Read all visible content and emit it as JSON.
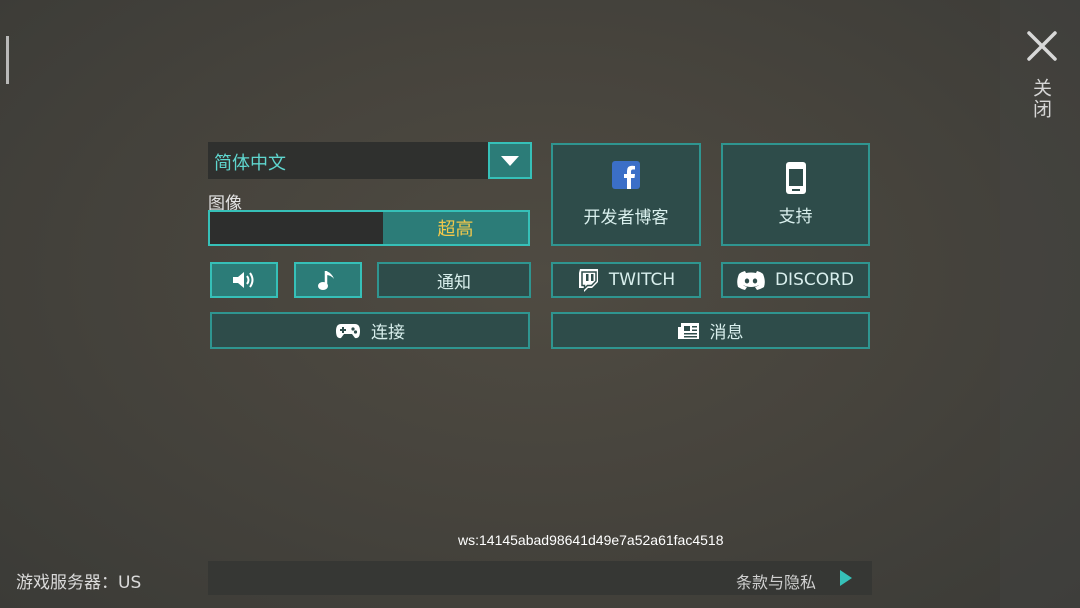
{
  "close": {
    "label": "关闭"
  },
  "language": {
    "selected": "简体中文"
  },
  "graphics": {
    "label": "图像",
    "quality": "超高"
  },
  "buttons": {
    "notify": "通知",
    "connect": "连接",
    "dev_blog": "开发者博客",
    "support": "支持",
    "twitch": "TWITCH",
    "discord": "DISCORD",
    "news": "消息"
  },
  "footer": {
    "server": "游戏服务器：US",
    "ws_id": "ws:14145abad98641d49e7a52a61fac4518",
    "terms": "条款与隐私"
  },
  "colors": {
    "accent": "#36c0b8",
    "button_bg": "#2e4c4a",
    "active_bg": "#2c7c78",
    "quality_text": "#f2c84b"
  },
  "icons": [
    "close-icon",
    "dropdown-arrow-icon",
    "speaker-icon",
    "music-note-icon",
    "gamepad-icon",
    "facebook-icon",
    "phone-icon",
    "twitch-icon",
    "discord-icon",
    "newspaper-icon",
    "play-arrow-icon"
  ]
}
